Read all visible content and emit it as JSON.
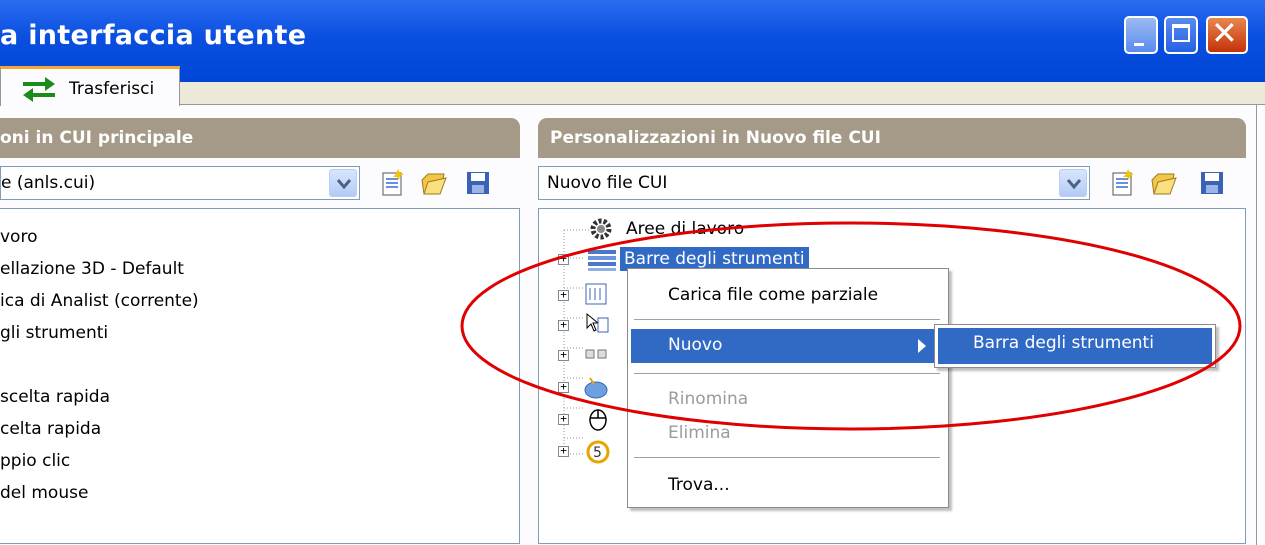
{
  "window": {
    "title": "a interfaccia utente",
    "controls": {
      "minimize": "minimize",
      "maximize": "maximize",
      "close": "close"
    }
  },
  "tabs": [
    {
      "label": "Trasferisci",
      "icon": "transfer-arrows-icon"
    }
  ],
  "left_panel": {
    "header": "oni in CUI principale",
    "combo_value": "e (anls.cui)",
    "items": [
      "voro",
      "ellazione 3D - Default",
      "ica di Analist (corrente)",
      "gli strumenti",
      "",
      "scelta rapida",
      "celta rapida",
      "ppio clic",
      "del mouse"
    ]
  },
  "right_panel": {
    "header": "Personalizzazioni in Nuovo file CUI",
    "combo_value": "Nuovo file CUI",
    "tree": {
      "root": "Aree di lavoro",
      "selected": "Barre degli strumenti"
    }
  },
  "context_menu": {
    "items": {
      "load_partial": "Carica file come parziale",
      "new": "Nuovo",
      "rename": "Rinomina",
      "delete": "Elimina",
      "find": "Trova..."
    },
    "submenu": {
      "new_toolbar": "Barra degli strumenti"
    }
  },
  "colors": {
    "titlebar": "#0a4fe0",
    "selection": "#316ac5",
    "panel_header": "#a59a87",
    "annotation_ellipse": "#e00000",
    "tab_accent": "#f3a536"
  }
}
